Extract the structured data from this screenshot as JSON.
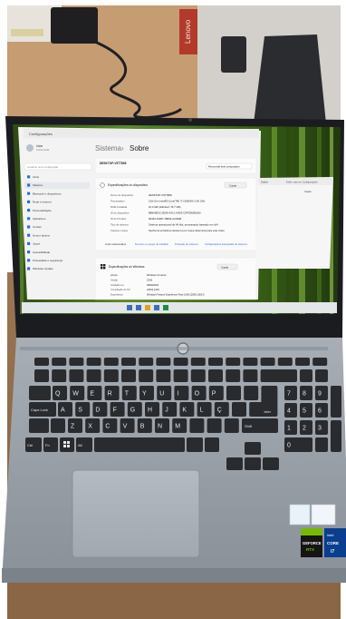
{
  "window": {
    "app_title": "Configurações",
    "breadcrumb_parent": "Sistema",
    "breadcrumb_separator": "›",
    "breadcrumb_current": "Sobre",
    "device_name": "DESKTOP-V5T7808",
    "rename_label": "Renomear este computador"
  },
  "sidebar": {
    "user_name": "Usar",
    "user_sub": "Conta local",
    "search_placeholder": "Localizar uma configuração",
    "items": [
      "Início",
      "Sistema",
      "Bluetooth e dispositivos",
      "Rede e Internet",
      "Personalização",
      "Aplicativos",
      "Contas",
      "Hora e idioma",
      "Jogos",
      "Acessibilidade",
      "Privacidade e segurança",
      "Windows Update"
    ]
  },
  "device_specs": {
    "section_title": "Especificações do dispositivo",
    "copy_label": "Copiar",
    "rows": [
      {
        "label": "Nome do dispositivo",
        "value": "DESKTOP-V5T7808"
      },
      {
        "label": "Processador",
        "value": "13th Gen Intel(R) Core(TM) i7-13650HX  2.60 GHz"
      },
      {
        "label": "RAM instalada",
        "value": "16,0 GB (utilizável: 15,7 GB)"
      },
      {
        "label": "ID do dispositivo",
        "value": "88BA5E0C-2E0A-43C1-A4D3-C0F9390E0260"
      },
      {
        "label": "ID do Produto",
        "value": "00342-43267-18629-AAOEM"
      },
      {
        "label": "Tipo de sistema",
        "value": "Sistema operacional de 64 bits, processador baseado em x64"
      },
      {
        "label": "Caneta e toque",
        "value": "Nenhuma entrada à caneta ou por toque disponível para este vídeo"
      }
    ],
    "related_links": [
      "Links relacionados",
      "Domínio ou grupo de trabalho",
      "Proteção do sistema",
      "Configurações avançadas do sistema"
    ]
  },
  "windows_specs": {
    "section_title": "Especificações do Windows",
    "copy_label": "Copiar",
    "rows": [
      {
        "label": "Edição",
        "value": "Windows 11 Home"
      },
      {
        "label": "Versão",
        "value": "22H2"
      },
      {
        "label": "Instalado em",
        "value": "08/09/2023"
      },
      {
        "label": "Compilação do SO",
        "value": "22621.2134"
      },
      {
        "label": "Experiência",
        "value": "Windows Feature Experience Pack 1000.22659.1000.0"
      }
    ]
  },
  "second_window": {
    "title_left": "Sobre",
    "title_right": "Exibir mais em Configurações",
    "copy_label": "Copiar"
  },
  "keyboard": {
    "row_qwerty": [
      "Q",
      "W",
      "E",
      "R",
      "T",
      "Y",
      "U",
      "I",
      "O",
      "P"
    ],
    "row_home": [
      "A",
      "S",
      "D",
      "F",
      "G",
      "H",
      "J",
      "K",
      "L",
      "Ç"
    ],
    "row_bottom": [
      "Z",
      "X",
      "C",
      "V",
      "B",
      "N",
      "M"
    ],
    "capslock_label": "Caps Lock",
    "enter_label": "Enter",
    "shift_label": "Shift",
    "ctrl_label": "Ctrl",
    "alt_label": "Alt",
    "fn_label": "Fn",
    "numpad": [
      "7",
      "8",
      "9",
      "4",
      "5",
      "6",
      "1",
      "2",
      "3",
      "0"
    ]
  },
  "stickers": {
    "intel_brand": "intel",
    "intel_tier": "CORE",
    "intel_gen": "i7",
    "nvidia_line1": "GEFORCE",
    "nvidia_line2": "RTX"
  },
  "background": {
    "box_brand": "Lenovo"
  },
  "colors": {
    "laptop_gray": "#9aa1a9",
    "keyboard_deck": "#8f969e",
    "key": "#2a2b2e",
    "screen_bezel": "#1b1c20",
    "desk_wood": "#8d6a4b",
    "box_cardboard": "#c69c73",
    "accent_blue": "#2b6ed6",
    "bamboo_green": "#3f6a1f"
  }
}
